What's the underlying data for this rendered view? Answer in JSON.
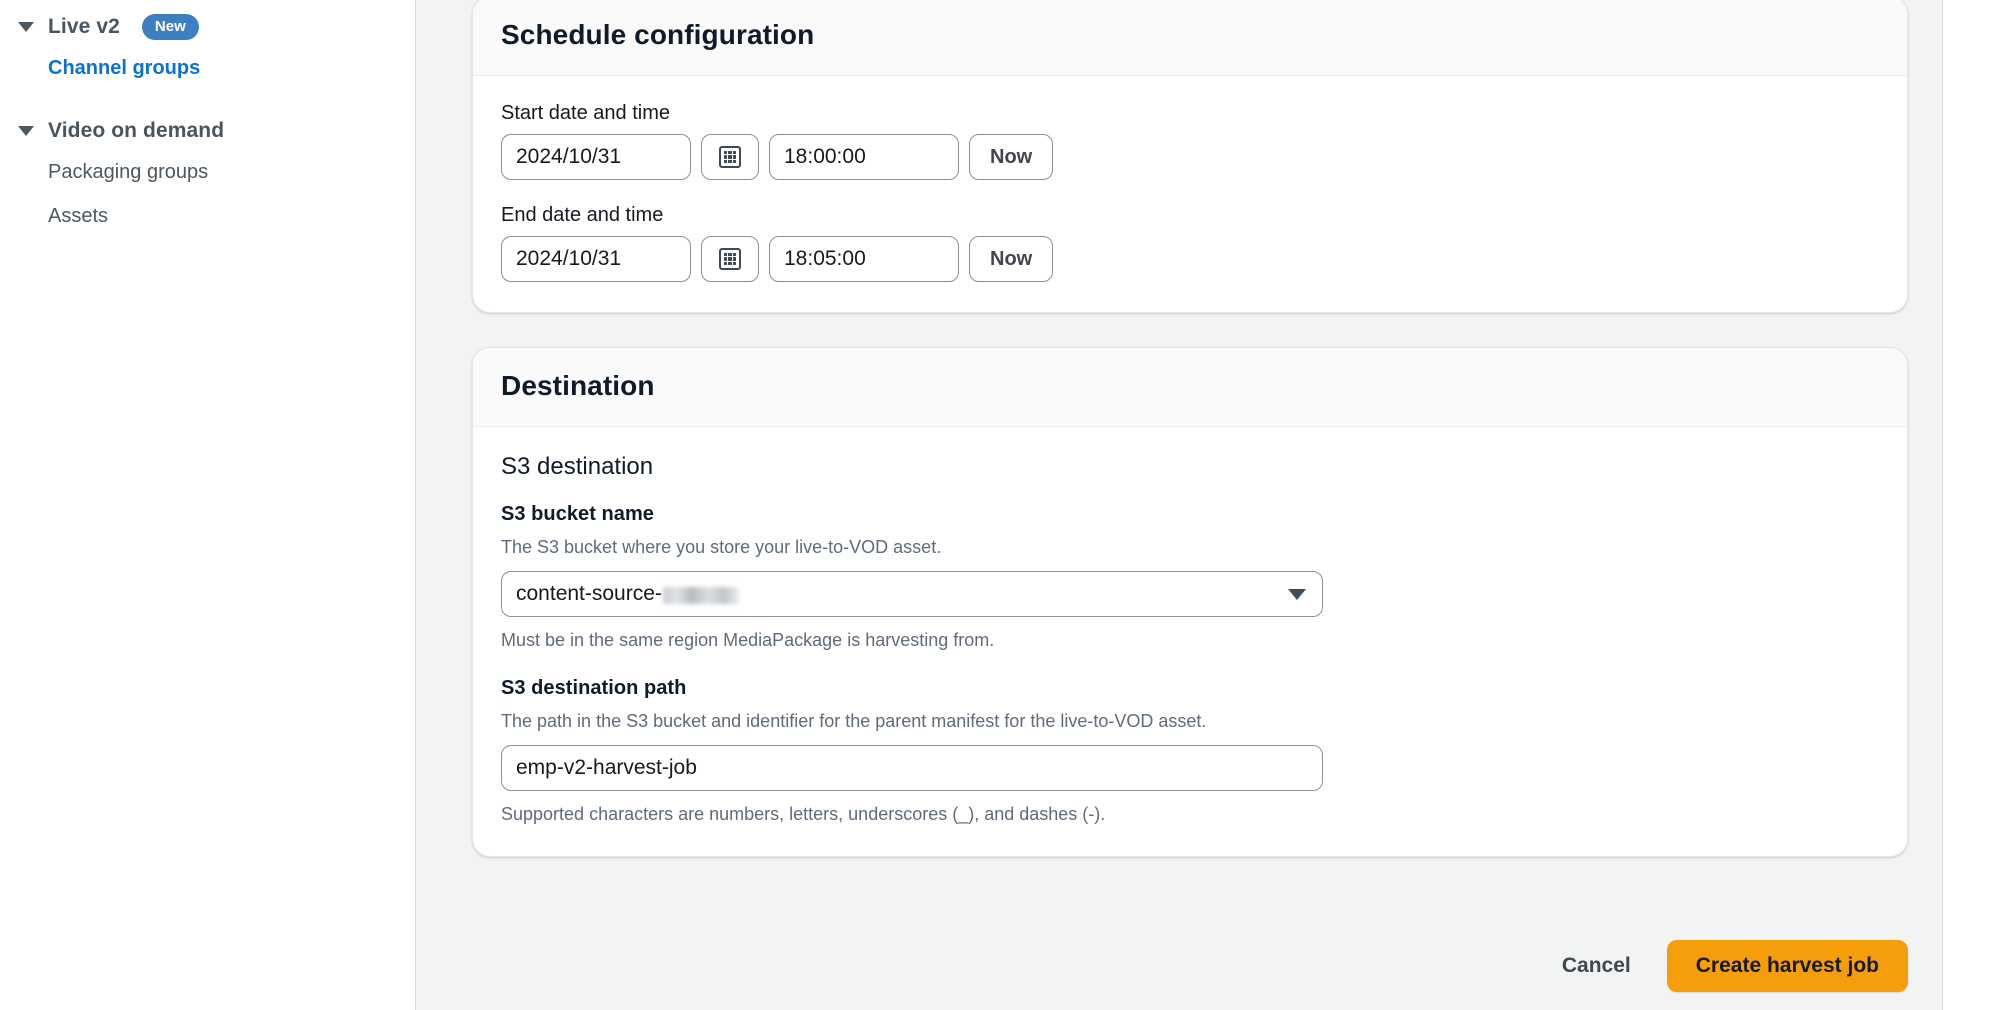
{
  "sidebar": {
    "groups": [
      {
        "title": "Live v2",
        "badge": "New",
        "caret_icon": "caret-down-icon",
        "items": [
          {
            "label": "Channel groups",
            "active": true
          }
        ]
      },
      {
        "title": "Video on demand",
        "badge": "",
        "caret_icon": "caret-down-icon",
        "items": [
          {
            "label": "Packaging groups",
            "active": false
          },
          {
            "label": "Assets",
            "active": false
          }
        ]
      }
    ]
  },
  "schedule_card": {
    "title": "Schedule configuration",
    "start": {
      "label": "Start date and time",
      "date_value": "2024/10/31",
      "time_value": "18:00:00",
      "calendar_icon": "calendar-icon",
      "now_label": "Now"
    },
    "end": {
      "label": "End date and time",
      "date_value": "2024/10/31",
      "time_value": "18:05:00",
      "calendar_icon": "calendar-icon",
      "now_label": "Now"
    }
  },
  "destination_card": {
    "title": "Destination",
    "section_title": "S3 destination",
    "bucket": {
      "label": "S3 bucket name",
      "description": "The S3 bucket where you store your live-to-VOD asset.",
      "selected_value": "content-source-",
      "redacted": true,
      "hint": "Must be in the same region MediaPackage is harvesting from.",
      "caret_icon": "chevron-down-icon"
    },
    "path": {
      "label": "S3 destination path",
      "description": "The path in the S3 bucket and identifier for the parent manifest for the live-to-VOD asset.",
      "value": "emp-v2-harvest-job",
      "hint": "Supported characters are numbers, letters, underscores (_), and dashes (-)."
    }
  },
  "footer": {
    "cancel_label": "Cancel",
    "submit_label": "Create harvest job"
  },
  "colors": {
    "accent_orange": "#f59d0a",
    "link_blue": "#0972d3",
    "badge_blue": "#3d7fc1",
    "page_bg": "#f2f3f3"
  }
}
